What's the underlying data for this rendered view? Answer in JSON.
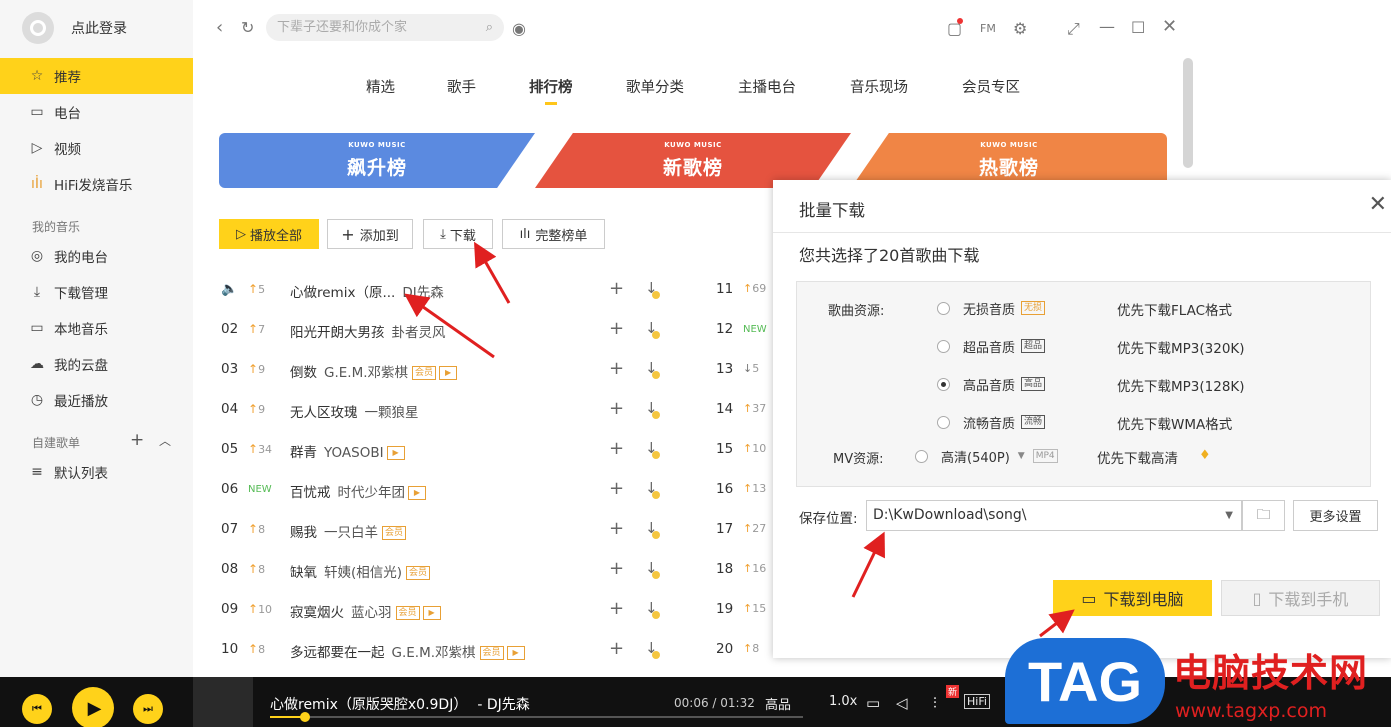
{
  "sidebar": {
    "login": "点此登录",
    "nav": [
      {
        "label": "推荐",
        "icon": "star-icon"
      },
      {
        "label": "电台",
        "icon": "radio-icon"
      },
      {
        "label": "视频",
        "icon": "video-icon"
      },
      {
        "label": "HiFi发烧音乐",
        "icon": "waveform-icon"
      }
    ],
    "my_music_title": "我的音乐",
    "my_music": [
      {
        "label": "我的电台",
        "icon": "radio-circle-icon"
      },
      {
        "label": "下载管理",
        "icon": "download-icon"
      },
      {
        "label": "本地音乐",
        "icon": "computer-icon"
      },
      {
        "label": "我的云盘",
        "icon": "cloud-icon"
      },
      {
        "label": "最近播放",
        "icon": "clock-icon"
      }
    ],
    "playlist_title": "自建歌单",
    "playlists": [
      {
        "label": "默认列表",
        "icon": "list-icon"
      }
    ]
  },
  "search": {
    "placeholder": "下辈子还要和你成个家"
  },
  "tabs": [
    "精选",
    "歌手",
    "排行榜",
    "歌单分类",
    "主播电台",
    "音乐现场",
    "会员专区"
  ],
  "active_tab": "排行榜",
  "banners": [
    {
      "brand": "KUWO MUSIC",
      "name": "飙升榜",
      "color": "#5b8ae0"
    },
    {
      "brand": "KUWO MUSIC",
      "name": "新歌榜",
      "color": "#e5533f"
    },
    {
      "brand": "KUWO MUSIC",
      "name": "热歌榜",
      "color": "#f08545"
    }
  ],
  "actions": {
    "play_all": "播放全部",
    "add_to": "添加到",
    "download": "下载",
    "full_chart": "完整榜单"
  },
  "songs": [
    {
      "num": "",
      "trend": "5",
      "dir": "up",
      "title": "心做remix（原...",
      "artist": "DJ先森",
      "badges": []
    },
    {
      "num": "02",
      "trend": "7",
      "dir": "up",
      "title": "阳光开朗大男孩",
      "artist": "卦者灵风",
      "badges": []
    },
    {
      "num": "03",
      "trend": "9",
      "dir": "up",
      "title": "倒数",
      "artist": "G.E.M.邓紫棋",
      "badges": [
        "会员",
        "▶"
      ]
    },
    {
      "num": "04",
      "trend": "9",
      "dir": "up",
      "title": "无人区玫瑰",
      "artist": "一颗狼星",
      "badges": []
    },
    {
      "num": "05",
      "trend": "34",
      "dir": "up",
      "title": "群青",
      "artist": "YOASOBI",
      "badges": [
        "▶"
      ]
    },
    {
      "num": "06",
      "trend": "NEW",
      "dir": "new",
      "title": "百忧戒",
      "artist": "时代少年团",
      "badges": [
        "▶"
      ]
    },
    {
      "num": "07",
      "trend": "8",
      "dir": "up",
      "title": "赐我",
      "artist": "一只白羊",
      "badges": [
        "会员"
      ]
    },
    {
      "num": "08",
      "trend": "8",
      "dir": "up",
      "title": "缺氧",
      "artist": "轩姨(相信光)",
      "badges": [
        "会员"
      ]
    },
    {
      "num": "09",
      "trend": "10",
      "dir": "up",
      "title": "寂寞烟火",
      "artist": "蓝心羽",
      "badges": [
        "会员",
        "▶"
      ]
    },
    {
      "num": "10",
      "trend": "8",
      "dir": "up",
      "title": "多远都要在一起",
      "artist": "G.E.M.邓紫棋",
      "badges": [
        "会员",
        "▶"
      ]
    }
  ],
  "right_list": [
    {
      "num": "11",
      "trend": "69",
      "dir": "up"
    },
    {
      "num": "12",
      "trend": "NEW",
      "dir": "new"
    },
    {
      "num": "13",
      "trend": "5",
      "dir": "down"
    },
    {
      "num": "14",
      "trend": "37",
      "dir": "up"
    },
    {
      "num": "15",
      "trend": "10",
      "dir": "up"
    },
    {
      "num": "16",
      "trend": "13",
      "dir": "up"
    },
    {
      "num": "17",
      "trend": "27",
      "dir": "up"
    },
    {
      "num": "18",
      "trend": "16",
      "dir": "up"
    },
    {
      "num": "19",
      "trend": "15",
      "dir": "up"
    },
    {
      "num": "20",
      "trend": "8",
      "dir": "up"
    }
  ],
  "dialog": {
    "title": "批量下载",
    "summary": "您共选择了20首歌曲下载",
    "source_label": "歌曲资源:",
    "options": [
      {
        "label": "无损音质",
        "tag": "无损",
        "desc": "优先下载FLAC格式",
        "selected": false
      },
      {
        "label": "超品音质",
        "tag": "超品",
        "desc": "优先下载MP3(320K)",
        "selected": false
      },
      {
        "label": "高品音质",
        "tag": "高品",
        "desc": "优先下载MP3(128K)",
        "selected": true
      },
      {
        "label": "流畅音质",
        "tag": "流畅",
        "desc": "优先下载WMA格式",
        "selected": false
      }
    ],
    "mv_label": "MV资源:",
    "mv_option": "高清(540P)",
    "mv_format": "MP4",
    "mv_desc": "优先下载高清",
    "save_label": "保存位置:",
    "save_path": "D:\\KwDownload\\song\\",
    "more_settings": "更多设置",
    "download_pc": "下载到电脑",
    "download_phone": "下载到手机"
  },
  "player": {
    "title": "心做remix（原版哭腔x0.9DJ）",
    "artist": "- DJ先森",
    "time": "00:06 / 01:32",
    "quality": "高品",
    "speed": "1.0x",
    "hifi": "HiFi",
    "new_badge": "新",
    "progress": 0.065
  },
  "watermark": {
    "logo": "TAG",
    "text": "电脑技术网",
    "url": "www.tagxp.com"
  }
}
